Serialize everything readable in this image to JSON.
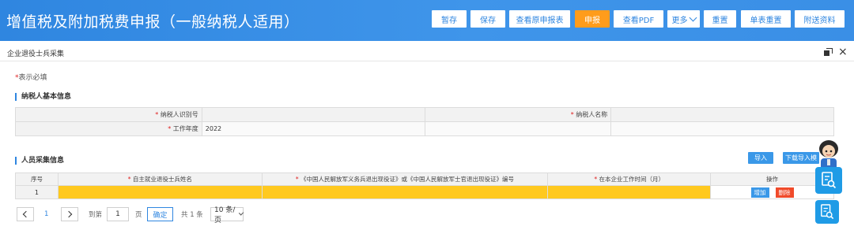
{
  "header": {
    "title": "增值税及附加税费申报（一般纳税人适用）",
    "buttons": {
      "draft": "暂存",
      "save": "保存",
      "view_original": "查看原申报表",
      "declare": "申报",
      "view_pdf": "查看PDF",
      "more": "更多",
      "reset": "重置",
      "single_reset": "单表重置",
      "attachments": "附送资料"
    }
  },
  "panel": {
    "title": "企业退役士兵采集",
    "required_note_star": "*",
    "required_note": "表示必填"
  },
  "basic_info": {
    "section_title": "纳税人基本信息",
    "taxpayer_id_label": "纳税人识别号",
    "taxpayer_id_value": "",
    "taxpayer_name_label": "纳税人名称",
    "taxpayer_name_value": "",
    "work_year_label": "工作年度",
    "work_year_value": "2022"
  },
  "personnel": {
    "section_title": "人员采集信息",
    "import_label": "导入",
    "download_template_label": "下载导入模",
    "columns": {
      "seq": "序号",
      "name": "自主就业退役士兵姓名",
      "cert": "《中国人民解放军义务兵退出现役证》或《中国人民解放军士官退出现役证》编号",
      "months": "在本企业工作时间（月）",
      "ops": "操作"
    },
    "rows": [
      {
        "seq": "1",
        "name": "",
        "cert": "",
        "months": ""
      }
    ],
    "add_label": "增加",
    "delete_label": "删除"
  },
  "pagination": {
    "current_page": "1",
    "goto_prefix": "到第",
    "goto_value": "1",
    "goto_suffix": "页",
    "confirm_label": "确定",
    "total_text": "共 1 条",
    "page_size": "10 条/页"
  },
  "colors": {
    "header_blue": "#2f86e0",
    "declare_orange": "#ff9c1b",
    "required_yellow": "#ffc91f",
    "delete_red": "#f04a2a"
  }
}
